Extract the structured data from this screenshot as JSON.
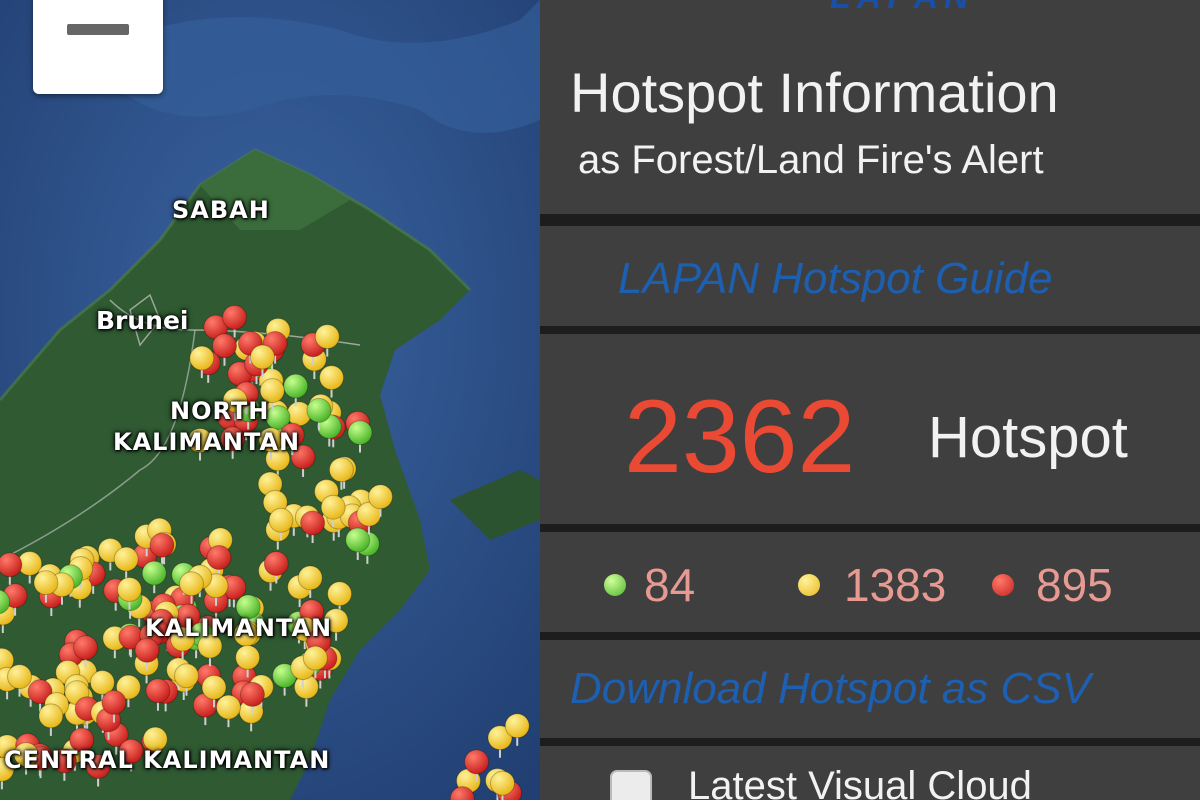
{
  "map": {
    "zoom_out_label": "−",
    "place_labels": [
      "SABAH",
      "Brunei",
      "NORTH",
      "KALIMANTAN",
      "KALIMANTAN",
      "CENTRAL KALIMANTAN"
    ]
  },
  "panel": {
    "top_logo_text": "LAPAN",
    "title_line1": "Hotspot Information",
    "title_line2": "as Forest/Land Fire's Alert",
    "guide_link": "LAPAN Hotspot Guide",
    "total_count": "2362",
    "total_label": "Hotspot",
    "counts": {
      "green": "84",
      "yellow": "1383",
      "red": "895"
    },
    "download_link": "Download Hotspot as CSV",
    "cloud_checkbox_label": "Latest Visual Cloud",
    "cloud_checkbox_checked": false
  },
  "colors": {
    "sea": "#2a4f86",
    "land": "#2f5a32",
    "panel_bg": "#3f3f3f",
    "count_red": "#ea4a33",
    "link_blue": "#1d5fb0",
    "marker_red": "#dd2b27",
    "marker_yellow": "#f1cf2a",
    "marker_green": "#6fd13a"
  },
  "icons": [
    "minus-icon",
    "hotspot-marker-icon",
    "checkbox-icon"
  ]
}
